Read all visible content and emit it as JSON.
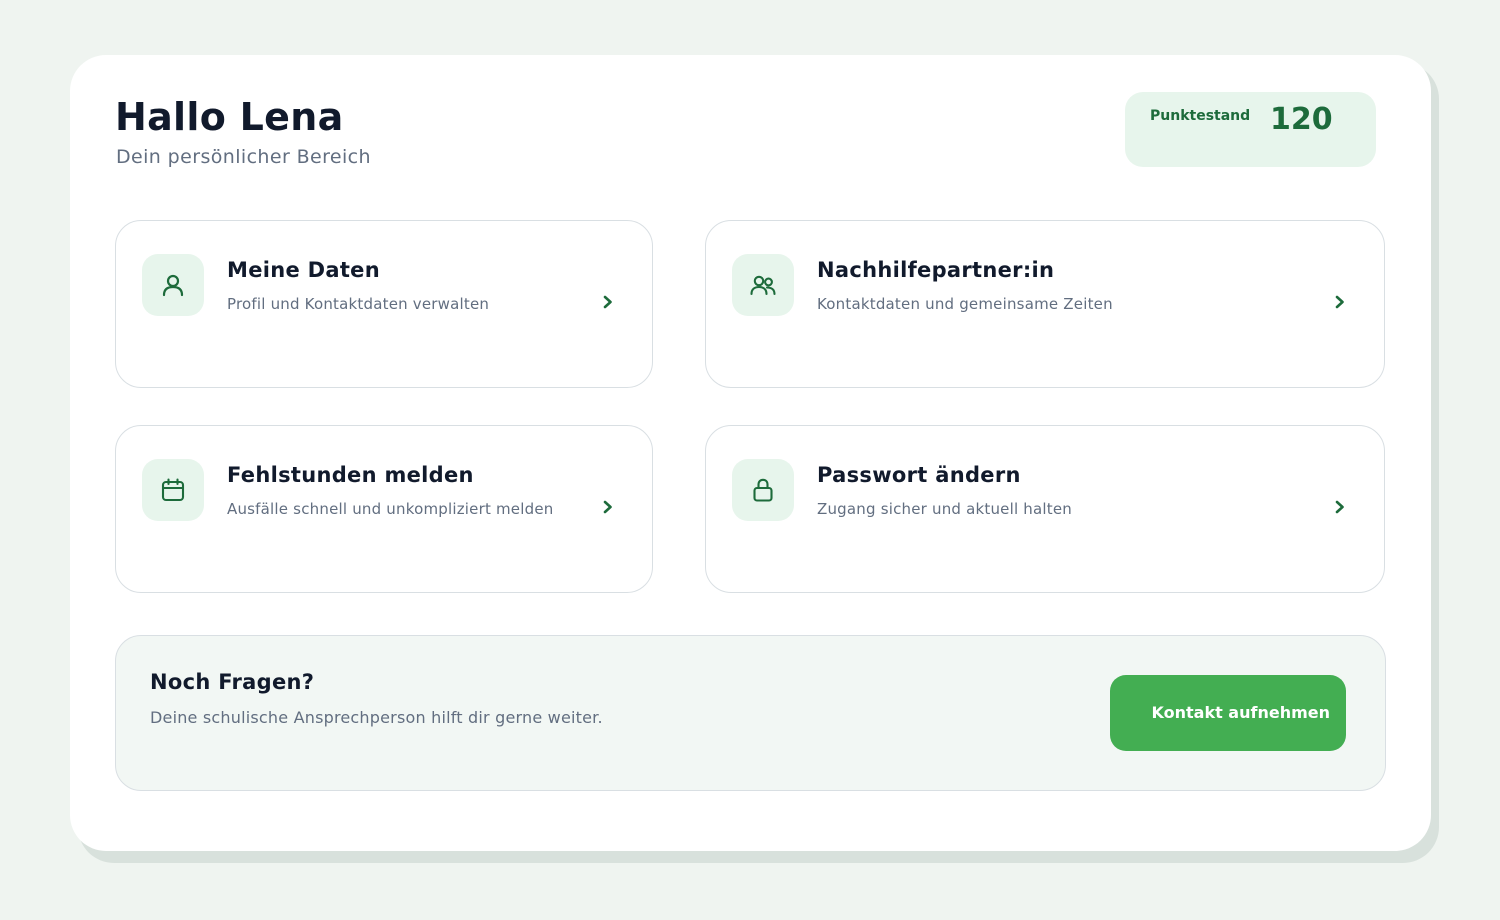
{
  "header": {
    "greeting": "Hallo Lena",
    "subtitle": "Dein persönlicher Bereich"
  },
  "points": {
    "label": "Punktestand",
    "value": "120"
  },
  "tiles": [
    {
      "title": "Meine Daten",
      "description": "Profil und Kontaktdaten verwalten",
      "icon": "user-icon"
    },
    {
      "title": "Nachhilfepartner:in",
      "description": "Kontaktdaten und gemeinsame Zeiten",
      "icon": "people-icon"
    },
    {
      "title": "Fehlstunden melden",
      "description": "Ausfälle schnell und unkompliziert melden",
      "icon": "calendar-icon"
    },
    {
      "title": "Passwort ändern",
      "description": "Zugang sicher und aktuell halten",
      "icon": "lock-icon"
    }
  ],
  "help": {
    "title": "Noch Fragen?",
    "text": "Deine schulische Ansprechperson hilft dir gerne weiter.",
    "button_label": "Kontakt aufnehmen"
  },
  "colors": {
    "accent": "#1d6b3b",
    "button": "#43ae52",
    "icon_background": "#e7f5ec",
    "page_background": "#eff4f0"
  }
}
